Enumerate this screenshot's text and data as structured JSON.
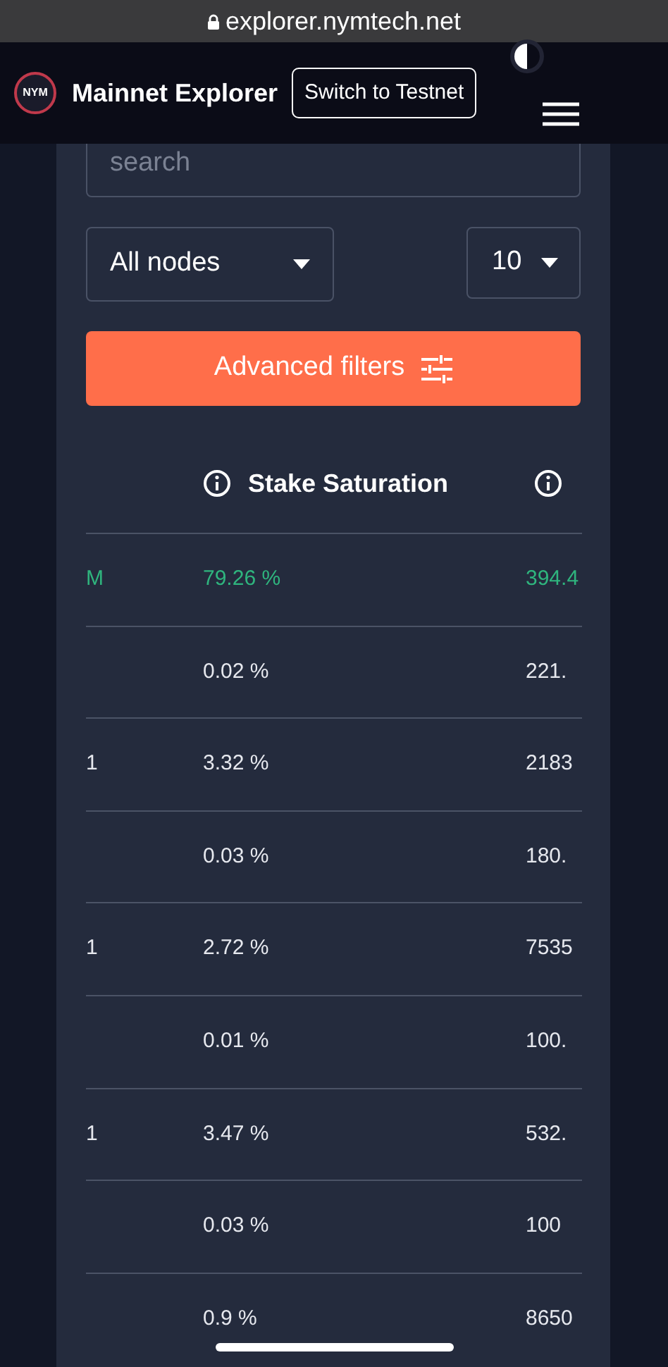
{
  "browser": {
    "url": "explorer.nymtech.net"
  },
  "header": {
    "logo": "NYM",
    "title": "Mainnet Explorer",
    "switch_button": "Switch to Testnet"
  },
  "search": {
    "placeholder": "search"
  },
  "filters": {
    "node_type": "All nodes",
    "page_size": "10",
    "advanced_button": "Advanced filters"
  },
  "table": {
    "columns": [
      "Stake Saturation"
    ],
    "rows": [
      {
        "column_1": "M",
        "stake_saturation": "79.26 %",
        "column_3": "394.4",
        "highlighted": true
      },
      {
        "column_1": "",
        "stake_saturation": "0.02 %",
        "column_3": "221.",
        "highlighted": false
      },
      {
        "column_1": "1",
        "stake_saturation": "3.32 %",
        "column_3": "2183",
        "highlighted": false
      },
      {
        "column_1": "",
        "stake_saturation": "0.03 %",
        "column_3": "180.",
        "highlighted": false
      },
      {
        "column_1": "1",
        "stake_saturation": "2.72 %",
        "column_3": "7535",
        "highlighted": false
      },
      {
        "column_1": "",
        "stake_saturation": "0.01 %",
        "column_3": "100.",
        "highlighted": false
      },
      {
        "column_1": "1",
        "stake_saturation": "3.47 %",
        "column_3": "532.",
        "highlighted": false
      },
      {
        "column_1": "",
        "stake_saturation": "0.03 %",
        "column_3": "100",
        "highlighted": false
      },
      {
        "column_1": "",
        "stake_saturation": "0.9 %",
        "column_3": "8650",
        "highlighted": false
      }
    ]
  }
}
